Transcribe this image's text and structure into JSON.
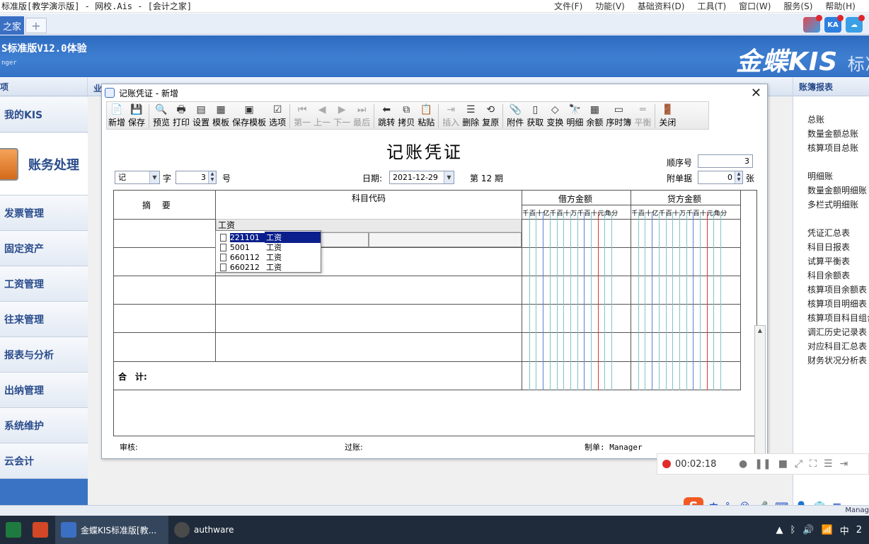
{
  "window": {
    "title": "标准版[教学演示版] - 网校.Ais - [会计之家]",
    "menu": [
      "文件(F)",
      "功能(V)",
      "基础资料(D)",
      "工具(T)",
      "窗口(W)",
      "服务(S)",
      "帮助(H)"
    ]
  },
  "tabs": {
    "home": "之家",
    "add": "+"
  },
  "top_icons": {
    "ka": "KA"
  },
  "banner": {
    "product": "S标准版V12.0体验",
    "user": "nger",
    "brand": "金蝶KIS",
    "brand_suffix": "标准"
  },
  "left_nav": {
    "header": "项",
    "items": [
      "我的KIS",
      "账务处理",
      "发票管理",
      "固定资产",
      "工资管理",
      "往来管理",
      "报表与分析",
      "出纳管理",
      "系统维护",
      "云会计"
    ]
  },
  "work_header": "业",
  "right_panel": {
    "header": "账簿报表",
    "groups": [
      [
        "总账",
        "数量金额总账",
        "核算项目总账"
      ],
      [
        "明细账",
        "数量金额明细账",
        "多栏式明细账"
      ],
      [
        "凭证汇总表",
        "科目日报表",
        "试算平衡表",
        "科目余额表",
        "核算项目余额表",
        "核算项目明细表",
        "核算项目科目组合",
        "调汇历史记录表",
        "对应科目汇总表",
        "财务状况分析表"
      ]
    ]
  },
  "dialog": {
    "title": "记账凭证 - 新增",
    "close": "✕",
    "toolbar": [
      {
        "label": "新增",
        "icon": "📄",
        "enabled": true
      },
      {
        "label": "保存",
        "icon": "💾",
        "enabled": true
      },
      {
        "sep": true
      },
      {
        "label": "预览",
        "icon": "🔍",
        "enabled": true
      },
      {
        "label": "打印",
        "icon": "🖶",
        "enabled": true
      },
      {
        "label": "设置",
        "icon": "▤",
        "enabled": true
      },
      {
        "label": "模板",
        "icon": "▦",
        "enabled": true
      },
      {
        "label": "保存模板",
        "icon": "▣",
        "enabled": true
      },
      {
        "label": "选项",
        "icon": "☑",
        "enabled": true
      },
      {
        "sep": true
      },
      {
        "label": "第一",
        "icon": "⏮",
        "enabled": false
      },
      {
        "label": "上一",
        "icon": "◀",
        "enabled": false
      },
      {
        "label": "下一",
        "icon": "▶",
        "enabled": false
      },
      {
        "label": "最后",
        "icon": "⏭",
        "enabled": false
      },
      {
        "sep": true
      },
      {
        "label": "跳转",
        "icon": "⬅",
        "enabled": true
      },
      {
        "label": "拷贝",
        "icon": "⧉",
        "enabled": true
      },
      {
        "label": "粘贴",
        "icon": "📋",
        "enabled": true
      },
      {
        "sep": true
      },
      {
        "label": "插入",
        "icon": "⇥",
        "enabled": false
      },
      {
        "label": "删除",
        "icon": "☰",
        "enabled": true
      },
      {
        "label": "复原",
        "icon": "⟲",
        "enabled": true
      },
      {
        "sep": true
      },
      {
        "label": "附件",
        "icon": "📎",
        "enabled": true
      },
      {
        "label": "获取",
        "icon": "▯",
        "enabled": true
      },
      {
        "label": "变换",
        "icon": "◇",
        "enabled": true
      },
      {
        "label": "明细",
        "icon": "🔭",
        "enabled": true
      },
      {
        "label": "余额",
        "icon": "▦",
        "enabled": true
      },
      {
        "label": "序时簿",
        "icon": "▭",
        "enabled": true
      },
      {
        "label": "平衡",
        "icon": "═",
        "enabled": false
      },
      {
        "sep": true
      },
      {
        "label": "关闭",
        "icon": "🚪",
        "enabled": true
      }
    ],
    "voucher_title": "记账凭证",
    "word_select": "记",
    "word_label": "字",
    "number": "3",
    "number_label": "号",
    "date_label": "日期:",
    "date": "2021-12-29",
    "period_label": "第 12 期",
    "seq_label": "顺序号",
    "seq": "3",
    "attach_label": "附单据",
    "attach": "0",
    "attach_unit": "张",
    "table": {
      "col_summary": "摘　 要",
      "col_account": "科目代码",
      "col_debit": "借方金额",
      "col_credit": "贷方金额",
      "digits": [
        "千",
        "百",
        "十",
        "亿",
        "千",
        "百",
        "十",
        "万",
        "千",
        "百",
        "十",
        "元",
        "角",
        "分"
      ],
      "total_label": "合　计:"
    },
    "account_input": "工资",
    "dropdown": [
      {
        "code": "221101",
        "name": "工资",
        "selected": true
      },
      {
        "code": "5001",
        "name": "工资",
        "selected": false
      },
      {
        "code": "660112",
        "name": "工资",
        "selected": false
      },
      {
        "code": "660212",
        "name": "工资",
        "selected": false
      }
    ],
    "footer": {
      "audit": "审核:",
      "posted": "过账:",
      "maker": "制单: Manager"
    }
  },
  "recorder": {
    "time": "00:02:18"
  },
  "ime": {
    "logo": "S",
    "lang": "中",
    "punct": "°,"
  },
  "taskbar": {
    "items": [
      {
        "label": "金蝶KIS标准版[教...",
        "color": "#3a6fc4"
      },
      {
        "label": "authware",
        "color": "#4a4a4a"
      }
    ],
    "tray_lang": "中",
    "clock_frag": "2"
  },
  "status_frag": "Manag",
  "colors": {
    "accent": "#3a6fc4",
    "selection": "#0b1f8c",
    "grid_cyan": "#7fc4cb",
    "grid_red": "#e03434"
  }
}
